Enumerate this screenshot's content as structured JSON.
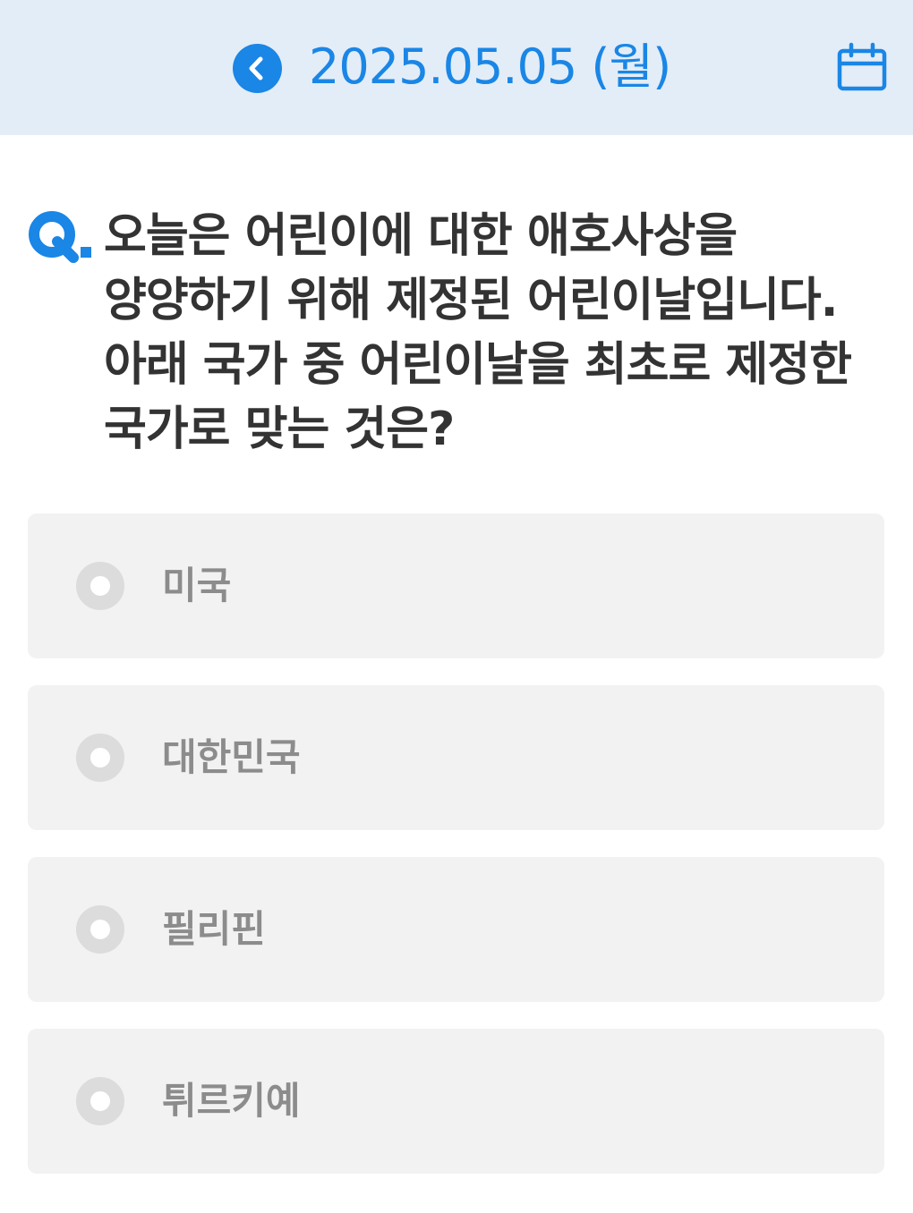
{
  "header": {
    "date_label": "2025.05.05 (월)",
    "prev_icon": "chevron-left-icon",
    "calendar_icon": "calendar-icon",
    "accent_color": "#1a86e6",
    "background_color": "#e3edf7"
  },
  "quiz": {
    "q_mark": "Q.",
    "question": "오늘은 어린이에 대한 애호사상을 양양하기 위해 제정된 어린이날입니다. 아래 국가 중 어린이날을 최초로 제정한 국가로 맞는 것은?",
    "options": [
      {
        "label": "미국",
        "selected": false
      },
      {
        "label": "대한민국",
        "selected": false
      },
      {
        "label": "필리핀",
        "selected": false
      },
      {
        "label": "튀르키예",
        "selected": false
      }
    ]
  }
}
